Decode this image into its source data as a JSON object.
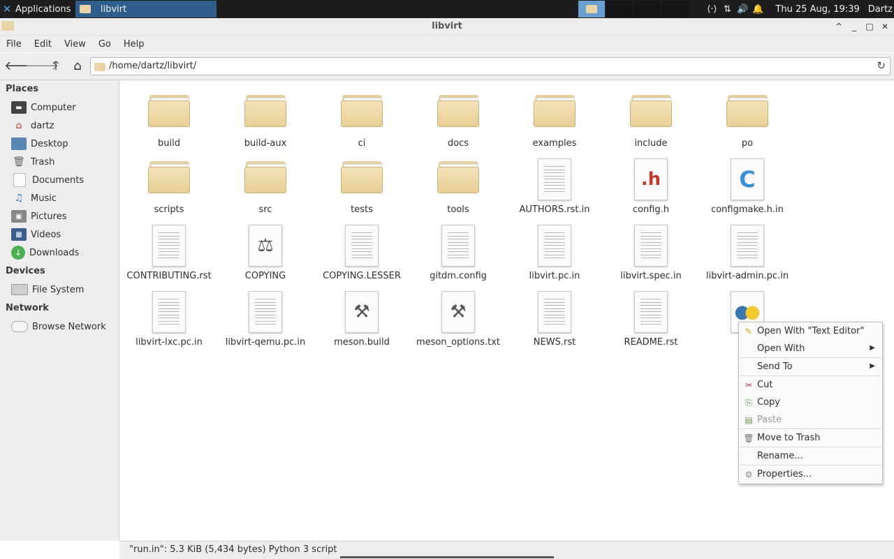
{
  "panel": {
    "applications_label": "Applications",
    "task_label": "libvirt",
    "clock": "Thu 25 Aug, 19:39",
    "user": "Dartz"
  },
  "window": {
    "title": "libvirt",
    "buttons": [
      "^",
      "_",
      "□",
      "✕"
    ]
  },
  "menubar": [
    "File",
    "Edit",
    "View",
    "Go",
    "Help"
  ],
  "toolbar": {
    "location": "/home/dartz/libvirt/"
  },
  "sidebar": {
    "places_header": "Places",
    "places": [
      {
        "label": "Computer",
        "icon": "computer-icon"
      },
      {
        "label": "dartz",
        "icon": "home-icon"
      },
      {
        "label": "Desktop",
        "icon": "desktop-icon"
      },
      {
        "label": "Trash",
        "icon": "trash-icon"
      },
      {
        "label": "Documents",
        "icon": "documents-icon"
      },
      {
        "label": "Music",
        "icon": "music-icon"
      },
      {
        "label": "Pictures",
        "icon": "pictures-icon"
      },
      {
        "label": "Videos",
        "icon": "videos-icon"
      },
      {
        "label": "Downloads",
        "icon": "downloads-icon"
      }
    ],
    "devices_header": "Devices",
    "devices": [
      {
        "label": "File System",
        "icon": "drive-icon"
      }
    ],
    "network_header": "Network",
    "network": [
      {
        "label": "Browse Network",
        "icon": "network-icon"
      }
    ]
  },
  "files": [
    {
      "name": "build",
      "type": "folder"
    },
    {
      "name": "build-aux",
      "type": "folder"
    },
    {
      "name": "ci",
      "type": "folder"
    },
    {
      "name": "docs",
      "type": "folder"
    },
    {
      "name": "examples",
      "type": "folder"
    },
    {
      "name": "include",
      "type": "folder"
    },
    {
      "name": "po",
      "type": "folder"
    },
    {
      "name": "scripts",
      "type": "folder"
    },
    {
      "name": "src",
      "type": "folder"
    },
    {
      "name": "tests",
      "type": "folder"
    },
    {
      "name": "tools",
      "type": "folder"
    },
    {
      "name": "AUTHORS.rst.in",
      "type": "text"
    },
    {
      "name": "config.h",
      "type": "header"
    },
    {
      "name": "configmake.h.in",
      "type": "c-source"
    },
    {
      "name": "CONTRIBUTING.rst",
      "type": "text"
    },
    {
      "name": "COPYING",
      "type": "license"
    },
    {
      "name": "COPYING.LESSER",
      "type": "text"
    },
    {
      "name": "gitdm.config",
      "type": "text"
    },
    {
      "name": "libvirt.pc.in",
      "type": "text"
    },
    {
      "name": "libvirt.spec.in",
      "type": "text"
    },
    {
      "name": "libvirt-admin.pc.in",
      "type": "text"
    },
    {
      "name": "libvirt-lxc.pc.in",
      "type": "text"
    },
    {
      "name": "libvirt-qemu.pc.in",
      "type": "text"
    },
    {
      "name": "meson.build",
      "type": "build"
    },
    {
      "name": "meson_options.txt",
      "type": "build"
    },
    {
      "name": "NEWS.rst",
      "type": "text"
    },
    {
      "name": "README.rst",
      "type": "text"
    },
    {
      "name": "",
      "type": "python"
    }
  ],
  "status": {
    "text": "\"run.in\": 5.3 KiB (5,434 bytes) Python 3 script"
  },
  "context_menu": [
    {
      "label": "Open With \"Text Editor\"",
      "icon": "edit-icon",
      "submenu": false,
      "enabled": true
    },
    {
      "label": "Open With",
      "icon": "",
      "submenu": true,
      "enabled": true
    },
    {
      "label": "Send To",
      "icon": "",
      "submenu": true,
      "enabled": true
    },
    {
      "label": "Cut",
      "icon": "cut-icon",
      "submenu": false,
      "enabled": true
    },
    {
      "label": "Copy",
      "icon": "copy-icon",
      "submenu": false,
      "enabled": true
    },
    {
      "label": "Paste",
      "icon": "paste-icon",
      "submenu": false,
      "enabled": false
    },
    {
      "label": "Move to Trash",
      "icon": "trash-icon",
      "submenu": false,
      "enabled": true
    },
    {
      "label": "Rename...",
      "icon": "",
      "submenu": false,
      "enabled": true
    },
    {
      "label": "Properties...",
      "icon": "properties-icon",
      "submenu": false,
      "enabled": true
    }
  ]
}
